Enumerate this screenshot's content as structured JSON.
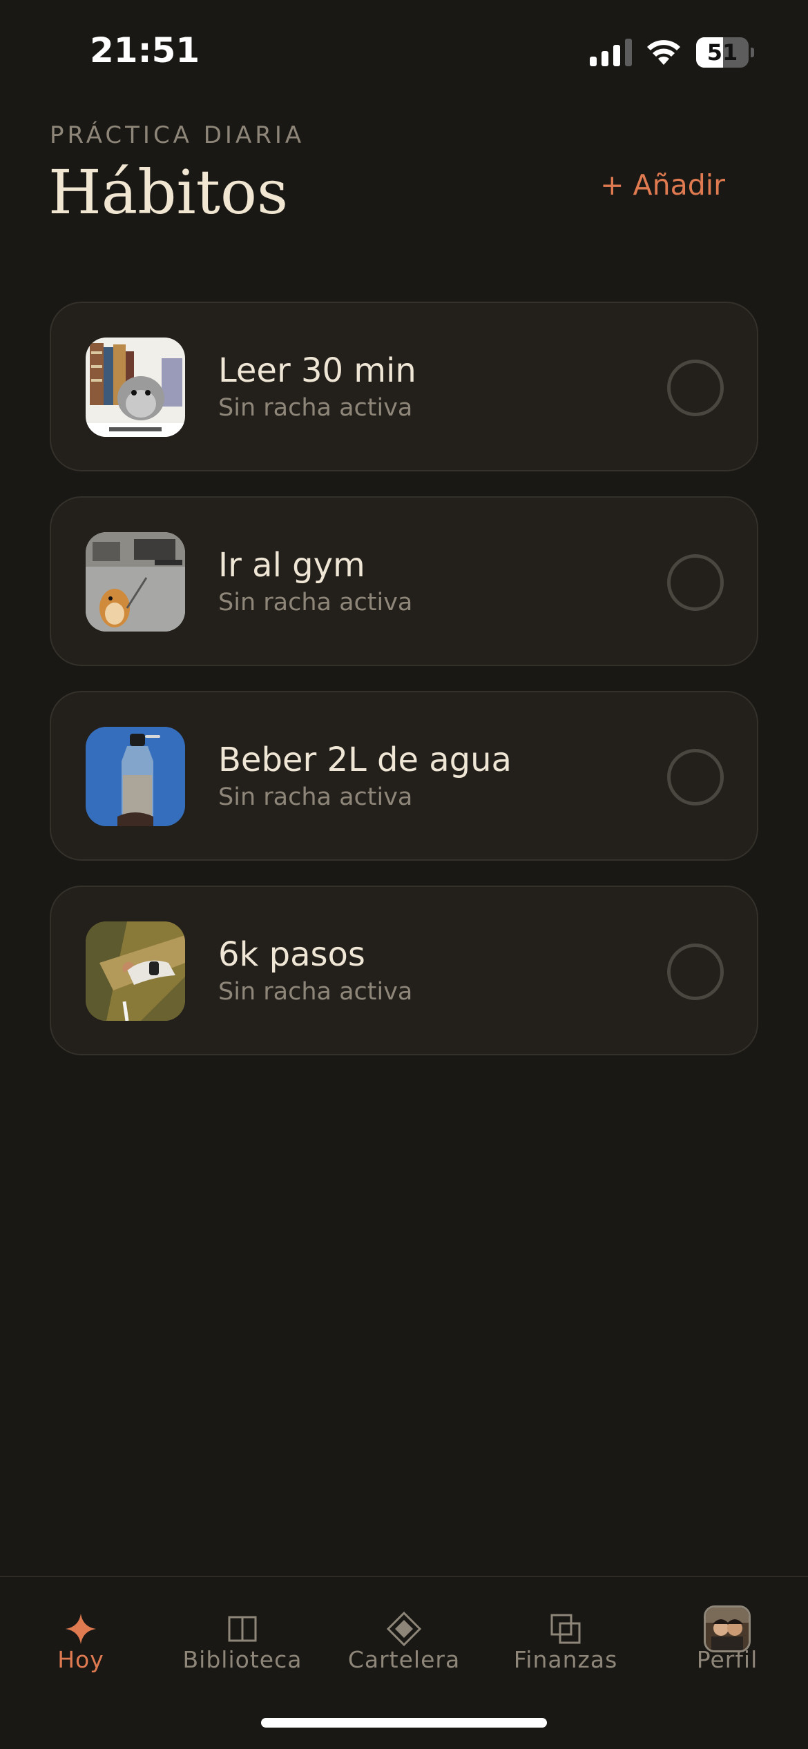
{
  "status_bar": {
    "time": "21:51",
    "battery_percent": "51"
  },
  "header": {
    "eyebrow": "PRÁCTICA DIARIA",
    "title": "Hábitos",
    "add_label": "+ Añadir"
  },
  "habits": [
    {
      "title": "Leer 30 min",
      "status": "Sin racha activa",
      "thumbnail": "hamster-with-books-image"
    },
    {
      "title": "Ir al gym",
      "status": "Sin racha activa",
      "thumbnail": "hamster-in-gym-image"
    },
    {
      "title": "Beber 2L de agua",
      "status": "Sin racha activa",
      "thumbnail": "water-bottle-image"
    },
    {
      "title": "6k pasos",
      "status": "Sin racha activa",
      "thumbnail": "walking-watch-image"
    }
  ],
  "tabs": [
    {
      "label": "Hoy",
      "icon": "sparkle-icon",
      "active": true
    },
    {
      "label": "Biblioteca",
      "icon": "book-icon",
      "active": false
    },
    {
      "label": "Cartelera",
      "icon": "diamond-icon",
      "active": false
    },
    {
      "label": "Finanzas",
      "icon": "layers-icon",
      "active": false
    },
    {
      "label": "Perfil",
      "icon": "avatar",
      "active": false
    }
  ],
  "colors": {
    "background": "#1a1815",
    "card": "#23201c",
    "accent": "#e07b51",
    "text": "#efe6d6",
    "muted": "#8e8679"
  }
}
